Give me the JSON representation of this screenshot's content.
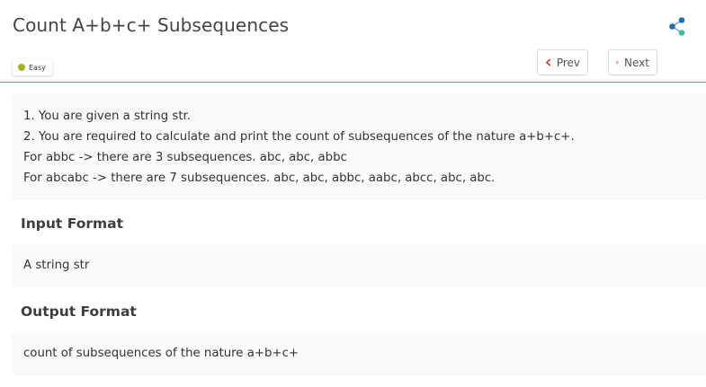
{
  "problem": {
    "title": "Count A+b+c+ Subsequences",
    "difficulty": "Easy",
    "difficulty_color": "#a8b11f"
  },
  "nav": {
    "prev_label": "Prev",
    "next_label": "Next",
    "prev_icon": "chevron-left-icon",
    "next_icon": "chevron-right-icon",
    "share_icon": "share-icon"
  },
  "description": {
    "lines": [
      "1. You are given a string str.",
      "2. You are required to calculate and print the count of subsequences of the nature a+b+c+.",
      "For abbc -> there are 3 subsequences. abc, abc, abbc",
      "For abcabc -> there are 7 subsequences. abc, abc, abbc, aabc, abcc, abc, abc."
    ]
  },
  "input_format": {
    "heading": "Input Format",
    "text": "A string str"
  },
  "output_format": {
    "heading": "Output Format",
    "text": "count of subsequences of the nature a+b+c+"
  },
  "colors": {
    "accent": "#e53935",
    "divider": "#e06666",
    "share_primary": "#1f6fb2",
    "share_secondary": "#3fb9a3"
  }
}
